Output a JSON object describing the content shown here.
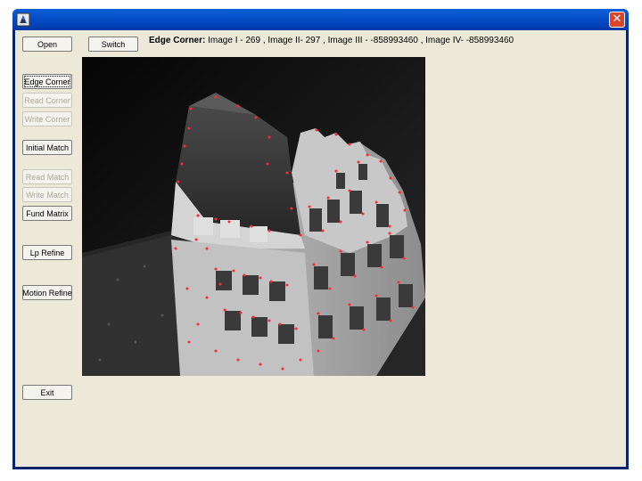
{
  "window": {
    "title": ""
  },
  "toolbar": {
    "open": "Open",
    "switch": "Switch",
    "edge_corner": "Edge Corner",
    "read_corner": "Read Corner",
    "write_corner": "Write Corner",
    "initial_match": "Initial Match",
    "read_match": "Read Match",
    "write_match": "Write Match",
    "fund_matrix": "Fund Matrix",
    "lp_refine": "Lp Refine",
    "motion_refine": "Motion Refine",
    "exit": "Exit"
  },
  "status": {
    "label": "Edge Corner:",
    "text": " Image I - 269 , Image II- 297 , Image III - -858993460 , Image IV- -858993460"
  },
  "image": {
    "description_icon": "building-photo-with-corner-markers"
  },
  "colors": {
    "corner_marker": "#ff2a2a",
    "titlebar": "#0348c0",
    "client_bg": "#ece9d8"
  }
}
